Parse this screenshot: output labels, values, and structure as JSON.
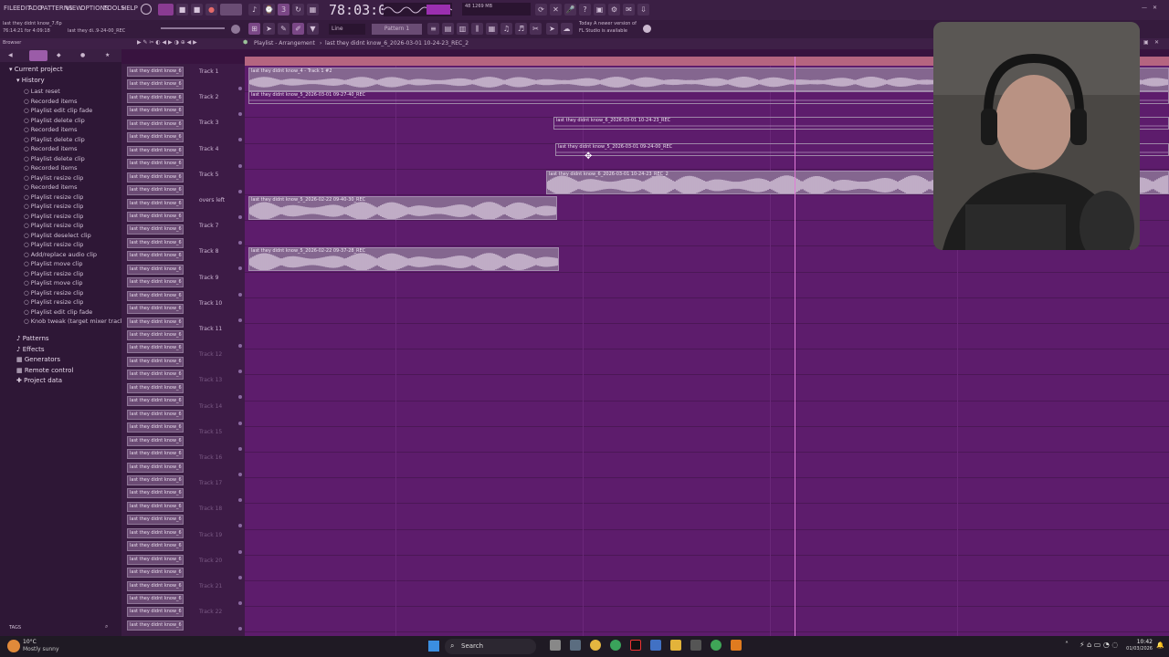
{
  "menu": [
    "FILE",
    "EDIT",
    "ADD",
    "PATTERNS",
    "VIEW",
    "OPTIONS",
    "TOOLS",
    "HELP"
  ],
  "project": {
    "file_line1": "last they didnt know_7.flp",
    "file_line2": "76:14:21 for 4:09:18",
    "hint": "last they di..9-24-00_REC"
  },
  "transport": {
    "time": "78:03:07",
    "mode": "Line",
    "tempo_label": "Pattern 1",
    "cpu": "48",
    "mem": "1269 MB"
  },
  "notice": {
    "line1": "Today  A newer version of",
    "line2": "FL Studio is available"
  },
  "playlist": {
    "title": "Playlist - Arrangement",
    "breadcrumb": "last they didnt know_6_2026-03-01 10-24-23_REC_2"
  },
  "browser": {
    "current_project": "Current project",
    "history": "History",
    "history_items": [
      "Last reset",
      "Recorded items",
      "Playlist edit clip fade",
      "Playlist delete clip",
      "Recorded items",
      "Playlist delete clip",
      "Recorded items",
      "Playlist delete clip",
      "Recorded items",
      "Playlist resize clip",
      "Recorded items",
      "Playlist resize clip",
      "Playlist resize clip",
      "Playlist resize clip",
      "Playlist resize clip",
      "Playlist deselect clip",
      "Playlist resize clip",
      "Add/replace audio clip",
      "Playlist move clip",
      "Playlist resize clip",
      "Playlist move clip",
      "Playlist resize clip",
      "Playlist resize clip",
      "Playlist edit clip fade",
      "Knob tweak (target mixer track)"
    ],
    "sections": [
      "Patterns",
      "Effects",
      "Generators",
      "Remote control",
      "Project data"
    ],
    "tags": "TAGS"
  },
  "sample_label": "last they didnt know_6",
  "tracks": [
    "Track 1",
    "Track 2",
    "Track 3",
    "Track 4",
    "Track 5",
    "overs left",
    "Track 7",
    "Track 8",
    "Track 9",
    "Track 10",
    "Track 11",
    "Track 12",
    "Track 13",
    "Track 14",
    "Track 15",
    "Track 16",
    "Track 17",
    "Track 18",
    "Track 19",
    "Track 20",
    "Track 21",
    "Track 22"
  ],
  "clips": [
    {
      "track": 0,
      "label": "last they didnt know_4 - Track 1 #2"
    },
    {
      "track": 1,
      "label": "last they didnt know_5_2026-03-01 09-27-40_REC"
    },
    {
      "track": 2,
      "label": "last they didnt know_6_2026-03-01 10-24-23_REC"
    },
    {
      "track": 3,
      "label": "last they didnt know_5_2026-03-01 09-24-00_REC"
    },
    {
      "track": 4,
      "label": "last they didnt know_6_2026-03-01 10-24-23_REC_2"
    },
    {
      "track": 5,
      "label": "last they didnt know_5_2026-02-22 09-40-30_REC"
    },
    {
      "track": 7,
      "label": "last they didnt know_5_2026-02-22 09-37-28_REC"
    }
  ],
  "taskbar": {
    "weather_temp": "10°C",
    "weather_desc": "Mostly sunny",
    "search": "Search",
    "clock_time": "10:42",
    "clock_date": "01/03/2026"
  },
  "colors": {
    "accent": "#b56580",
    "playlist_bg": "#5d1c6c",
    "clip": "#84668f"
  }
}
